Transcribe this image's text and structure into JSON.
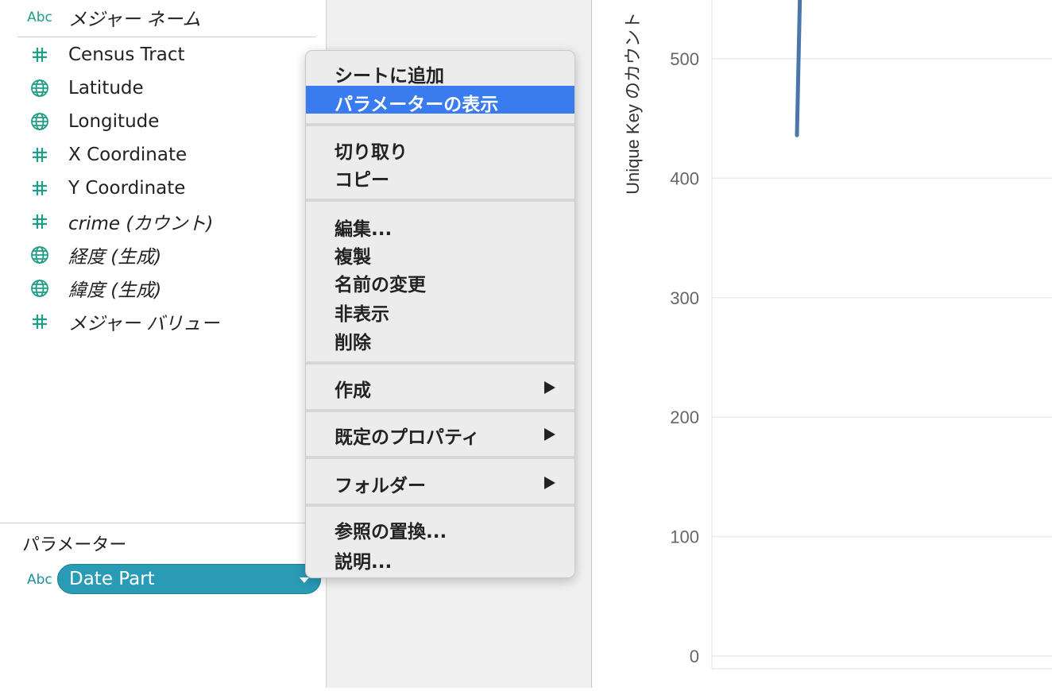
{
  "data_pane": {
    "header": {
      "type_icon": "Abc",
      "label": "メジャー ネーム"
    },
    "fields": [
      {
        "icon": "hash-icon",
        "label": "Census Tract",
        "italic": false
      },
      {
        "icon": "globe-icon",
        "label": "Latitude",
        "italic": false
      },
      {
        "icon": "globe-icon",
        "label": "Longitude",
        "italic": false
      },
      {
        "icon": "hash-icon",
        "label": "X Coordinate",
        "italic": false
      },
      {
        "icon": "hash-icon",
        "label": "Y Coordinate",
        "italic": false
      },
      {
        "icon": "hash-icon",
        "label": "crime (カウント)",
        "italic": true
      },
      {
        "icon": "globe-icon",
        "label": "経度 (生成)",
        "italic": true
      },
      {
        "icon": "globe-icon",
        "label": "緯度 (生成)",
        "italic": true
      },
      {
        "icon": "hash-icon",
        "label": "メジャー バリュー",
        "italic": true
      }
    ],
    "parameters": {
      "title": "パラメーター",
      "item": {
        "type_icon": "Abc",
        "label": "Date Part"
      }
    }
  },
  "context_menu": {
    "items": [
      {
        "label": "シートに追加"
      },
      {
        "label": "パラメーターの表示",
        "highlighted": true
      },
      {
        "label": "切り取り"
      },
      {
        "label": "コピー"
      },
      {
        "label": "編集..."
      },
      {
        "label": "複製"
      },
      {
        "label": "名前の変更"
      },
      {
        "label": "非表示"
      },
      {
        "label": "削除"
      },
      {
        "label": "作成",
        "submenu": true
      },
      {
        "label": "既定のプロパティ",
        "submenu": true
      },
      {
        "label": "フォルダー",
        "submenu": true
      },
      {
        "label": "参照の置換..."
      },
      {
        "label": "説明..."
      }
    ],
    "highlight_color": "#3a7cf0"
  },
  "chart_data": {
    "type": "line",
    "ylabel": "Unique Key のカウント",
    "yticks": [
      "500",
      "400",
      "300",
      "200",
      "100",
      "0"
    ],
    "ytick_values": [
      500,
      400,
      300,
      200,
      100,
      0
    ],
    "ylim": [
      0,
      550
    ],
    "series": [
      {
        "color": "#4a76a8",
        "points": [
          [
            0,
            436
          ],
          [
            1,
            560
          ]
        ]
      }
    ],
    "grid": true
  }
}
